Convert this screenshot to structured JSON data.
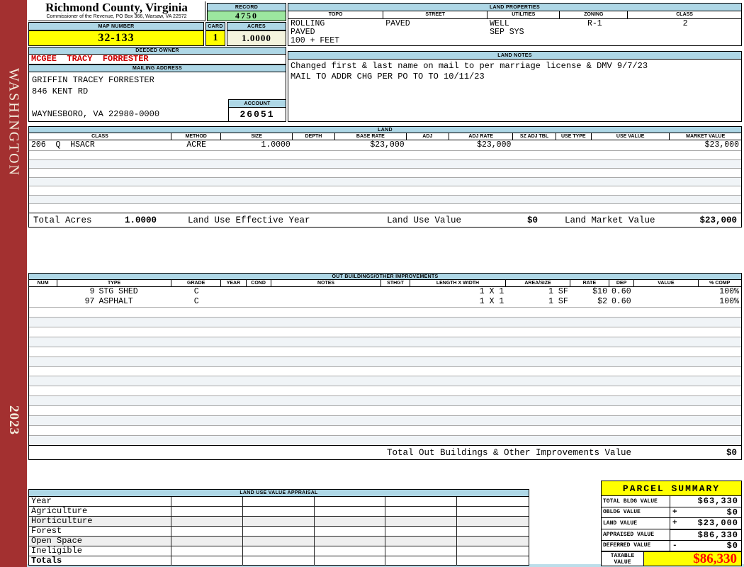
{
  "header": {
    "county": "Richmond County, Virginia",
    "office_line": "Commissioner of the Revenue, PO Box 366, Warsaw, VA 22572"
  },
  "record": {
    "label": "RECORD",
    "value": "4750"
  },
  "map_number": {
    "label": "MAP NUMBER",
    "value": "32-133"
  },
  "card": {
    "label": "CARD",
    "value": "1"
  },
  "acres": {
    "label": "ACRES",
    "value": "1.0000"
  },
  "deeded_owner": {
    "label": "DEEDED OWNER",
    "value": "MCGEE  TRACY  FORRESTER"
  },
  "mailing_address": {
    "label": "MAILING ADDRESS",
    "lines": [
      "GRIFFIN TRACEY FORRESTER",
      "846 KENT RD",
      "",
      "WAYNESBORO, VA 22980-0000"
    ]
  },
  "account": {
    "label": "ACCOUNT",
    "value": "26051"
  },
  "land_properties": {
    "label": "LAND PROPERTIES",
    "columns": [
      "TOPO",
      "STREET",
      "UTILITIES",
      "ZONING",
      "CLASS"
    ],
    "rows": [
      [
        "ROLLING",
        "PAVED",
        "WELL",
        "R-1",
        "2"
      ],
      [
        "PAVED",
        "",
        "SEP SYS",
        "",
        ""
      ],
      [
        "100 + FEET",
        "",
        "",
        "",
        ""
      ]
    ]
  },
  "land_notes": {
    "label": "LAND NOTES",
    "lines": [
      "Changed first & last name on mail to per marriage license & DMV 9/7/23",
      "MAIL TO ADDR CHG PER PO TO TO 10/11/23"
    ]
  },
  "land_table": {
    "title": "LAND",
    "headers": [
      "CLASS",
      "METHOD",
      "SIZE",
      "DEPTH",
      "BASE RATE",
      "ADJ",
      "ADJ RATE",
      "SZ ADJ TBL",
      "USE TYPE",
      "USE VALUE",
      "MARKET VALUE"
    ],
    "rows": [
      [
        "206  Q  HSACR",
        "ACRE",
        "1.0000",
        "",
        "$23,000",
        "",
        "$23,000",
        "",
        "",
        "",
        "$23,000"
      ]
    ],
    "empty_rows": 7,
    "totals": {
      "acres_label": "Total Acres",
      "acres": "1.0000",
      "effective_year_label": "Land Use Effective Year",
      "use_value_label": "Land Use Value",
      "use_value": "$0",
      "market_value_label": "Land Market Value",
      "market_value": "$23,000"
    }
  },
  "out_buildings": {
    "title": "OUT BUILDINGS/OTHER IMPROVEMENTS",
    "headers": [
      "NUM",
      "TYPE",
      "GRADE",
      "YEAR",
      "COND",
      "NOTES",
      "STHGT",
      "LENGTH X WIDTH",
      "AREA/SIZE",
      "RATE",
      "DEP",
      "VALUE",
      "% COMP"
    ],
    "rows": [
      [
        "9",
        "STG SHED",
        "C",
        "",
        "",
        "",
        "",
        "1 X 1",
        "1 SF",
        "$10",
        "0.60",
        "",
        "100%"
      ],
      [
        "97",
        "ASPHALT",
        "C",
        "",
        "",
        "",
        "",
        "1 X 1",
        "1 SF",
        "$2",
        "0.60",
        "",
        "100%"
      ]
    ],
    "empty_rows": 14,
    "total_label": "Total Out Buildings & Other Improvements Value",
    "total_value": "$0"
  },
  "land_use_appraisal": {
    "title": "LAND USE VALUE APPRAISAL",
    "row_labels": [
      "Year",
      "Agriculture",
      "Horticulture",
      "Forest",
      "Open Space",
      "Ineligible",
      "Totals"
    ],
    "data_columns": 5
  },
  "parcel_summary": {
    "title": "PARCEL SUMMARY",
    "rows": [
      {
        "label": "TOTAL BLDG VALUE",
        "sign": "",
        "value": "$63,330"
      },
      {
        "label": "OBLDG VALUE",
        "sign": "+",
        "value": "$0"
      },
      {
        "label": "LAND VALUE",
        "sign": "+",
        "value": "$23,000"
      },
      {
        "label": "APPRAISED VALUE",
        "sign": "",
        "value": "$86,330"
      },
      {
        "label": "DEFERRED VALUE",
        "sign": "-",
        "value": "$0"
      }
    ],
    "taxable": {
      "label_line1": "TAXABLE",
      "label_line2": "VALUE",
      "value": "$86,330"
    }
  },
  "sidebar": {
    "district": "WASHINGTON",
    "year": "2023"
  },
  "colors": {
    "sidebar_red": "#A33030",
    "header_blue": "#AED7E6",
    "record_green": "#9CE79F",
    "highlight_yellow": "#FFFF00",
    "acres_cream": "#F4F4DE",
    "owner_red": "#CC0000",
    "taxable_red": "#FF0000"
  }
}
